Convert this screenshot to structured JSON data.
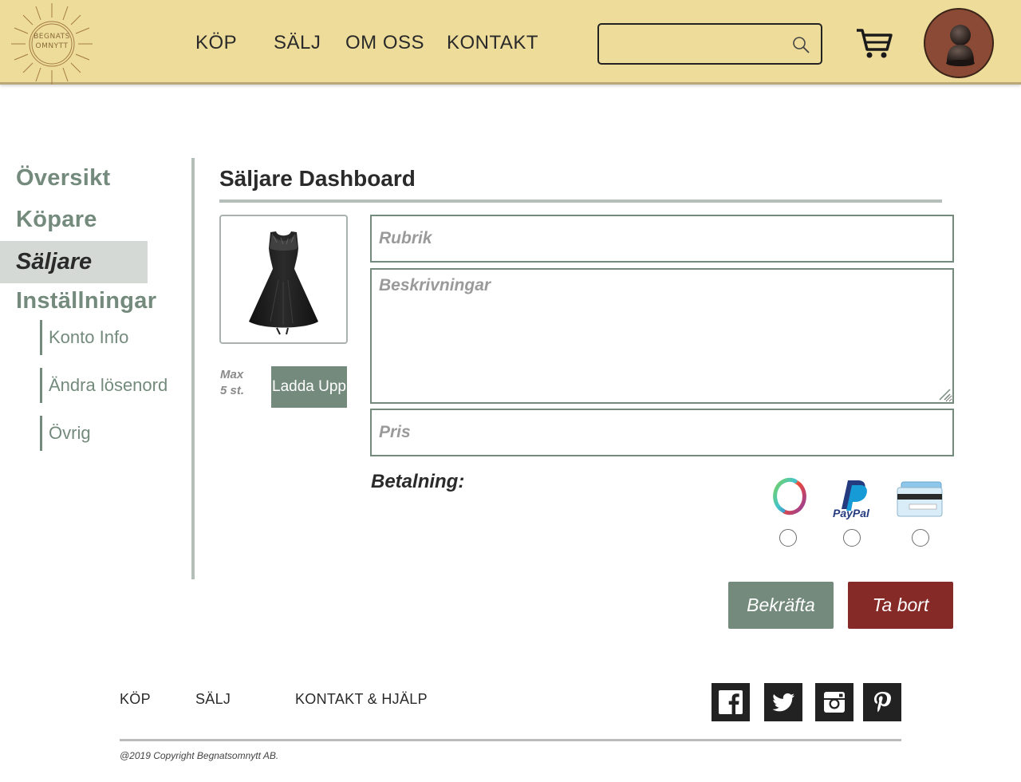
{
  "header": {
    "logo_text": [
      "BEGNATS",
      "OMNYTT"
    ],
    "nav": [
      "KÖP",
      "SÄLJ",
      "OM OSS",
      "KONTAKT"
    ],
    "search_placeholder": "",
    "search_icon": "search-icon",
    "cart_icon": "cart-icon",
    "avatar_icon": "user-avatar-icon"
  },
  "sidebar": {
    "items": [
      {
        "label": "Översikt",
        "active": false
      },
      {
        "label": "Köpare",
        "active": false
      },
      {
        "label": "Säljare",
        "active": true
      },
      {
        "label": "Inställningar",
        "active": false
      }
    ],
    "subitems": [
      "Konto Info",
      "Ändra lösenord",
      "Övrig"
    ]
  },
  "main": {
    "title": "Säljare Dashboard",
    "photo_icon": "black-dress-image",
    "max_text_line1": "Max",
    "max_text_line2": "5 st.",
    "upload_label": "Ladda Upp",
    "form": {
      "title_placeholder": "Rubrik",
      "title_value": "",
      "description_placeholder": "Beskrivningar",
      "description_value": "",
      "price_placeholder": "Pris",
      "price_value": ""
    },
    "payment_label": "Betalning:",
    "payment_methods": [
      {
        "name": "swish-icon",
        "selected": false
      },
      {
        "name": "paypal-icon",
        "selected": false,
        "label": "PayPal"
      },
      {
        "name": "card-icon",
        "selected": false
      }
    ],
    "confirm_label": "Bekräfta",
    "delete_label": "Ta bort"
  },
  "footer": {
    "links": [
      "KÖP",
      "SÄLJ",
      "KONTAKT & HJÄLP"
    ],
    "social": [
      "facebook-icon",
      "twitter-icon",
      "instagram-icon",
      "pinterest-icon"
    ],
    "copyright": "@2019 Copyright Begnatsomnytt AB."
  },
  "colors": {
    "header_bg": "#eedc9a",
    "accent_green": "#738a7c",
    "delete_red": "#862a28",
    "avatar_bg": "#8b4a35"
  }
}
